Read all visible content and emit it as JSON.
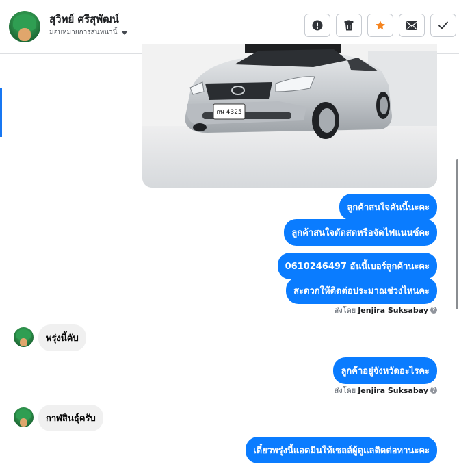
{
  "header": {
    "user_name": "สุวิทย์ ศรีสุพัฒน์",
    "assign_label": "มอบหมายการสนทนานี้",
    "actions": [
      {
        "name": "report-button",
        "icon": "exclamation-icon"
      },
      {
        "name": "delete-button",
        "icon": "trash-icon"
      },
      {
        "name": "star-button",
        "icon": "star-icon",
        "color": "#f5841f"
      },
      {
        "name": "unread-button",
        "icon": "envelope-icon"
      },
      {
        "name": "done-button",
        "icon": "check-icon"
      }
    ]
  },
  "attachment": {
    "plate_text": "กน 4325"
  },
  "messages": [
    {
      "side": "out",
      "text": "ลูกค้าสนใจคันนี้นะคะ"
    },
    {
      "side": "out",
      "text": "ลูกค้าสนใจตัดสดหรือจัดไฟแนนซ์คะ"
    },
    {
      "side": "out",
      "text": "0610246497  อันนี้เบอร์ลูกค้านะคะ"
    },
    {
      "side": "out",
      "text": "สะดวกให้ติดต่อประมาณช่วงไหนคะ"
    },
    {
      "side": "out",
      "text": "ลูกค้าอยู่จังหวัดอะไรคะ"
    },
    {
      "side": "in",
      "text": "พรุ่งนี้คับ"
    },
    {
      "side": "in",
      "text": "กาฬสินธุ์ครับ"
    },
    {
      "side": "out",
      "text": "เดี๋ยวพรุ่งนี้แอดมินให้เซลล์ผู้ดูแลติดต่อหานะคะ"
    }
  ],
  "sent_by": {
    "prefix": "ส่งโดย",
    "name": "Jenjira Suksabay",
    "help_glyph": "?"
  },
  "colors": {
    "outgoing_bubble": "#0a7cff",
    "incoming_bubble": "#f0f0f0",
    "accent": "#1877f2"
  }
}
